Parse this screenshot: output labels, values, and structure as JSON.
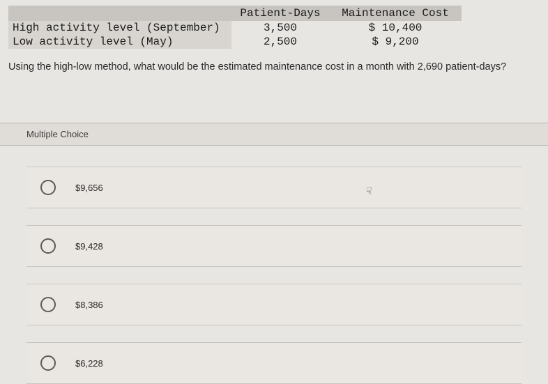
{
  "table": {
    "headers": {
      "label": "",
      "col1": "Patient-Days",
      "col2": "Maintenance Cost"
    },
    "rows": [
      {
        "label": "High activity level (September)",
        "col1": "3,500",
        "col2": "$ 10,400"
      },
      {
        "label": "Low activity level (May)",
        "col1": "2,500",
        "col2": "$ 9,200"
      }
    ]
  },
  "question": "Using the high-low method, what would be the estimated maintenance cost in a month with 2,690 patient-days?",
  "mc_header": "Multiple Choice",
  "choices": [
    {
      "label": "$9,656"
    },
    {
      "label": "$9,428"
    },
    {
      "label": "$8,386"
    },
    {
      "label": "$6,228"
    }
  ]
}
